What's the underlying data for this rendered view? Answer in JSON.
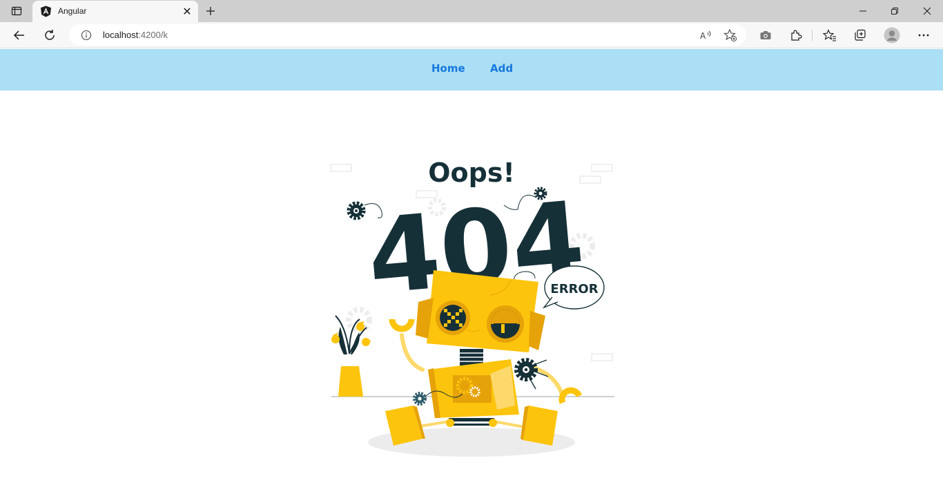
{
  "browser": {
    "tab": {
      "title": "Angular",
      "favicon": "angular-icon",
      "close_glyph": "✕"
    },
    "address_bar": {
      "url_host": "localhost",
      "url_rest": ":4200/k"
    },
    "icons": [
      "sidebar-toggle-icon",
      "angular-icon",
      "close-icon",
      "plus-icon",
      "minimize-icon",
      "restore-icon",
      "close-window-icon",
      "back-icon",
      "refresh-icon",
      "info-icon",
      "read-aloud-icon",
      "add-favorite-icon",
      "screenshot-icon",
      "extensions-icon",
      "favorites-icon",
      "collections-icon",
      "profile-icon",
      "more-icon"
    ]
  },
  "navbar": {
    "links": [
      {
        "label": "Home"
      },
      {
        "label": "Add"
      }
    ]
  },
  "illustration": {
    "oops_text": "Oops!",
    "code_text": "404",
    "bubble_text": "ERROR"
  },
  "colors": {
    "navbar_bg": "#abdff5",
    "link": "#1677dd",
    "robot_yellow": "#fcc40c",
    "robot_orange": "#e6a209",
    "dark_navy": "#163038"
  }
}
